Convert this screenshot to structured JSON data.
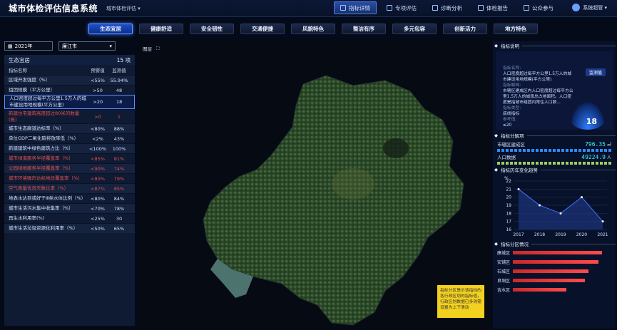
{
  "header": {
    "title": "城市体检评估信息系统",
    "system_select": "城市体检评估 ▾",
    "nav": [
      {
        "label": "指标详情",
        "active": true
      },
      {
        "label": "专项评估",
        "active": false
      },
      {
        "label": "诊断分析",
        "active": false
      },
      {
        "label": "体检报告",
        "active": false
      },
      {
        "label": "公众参与",
        "active": false
      }
    ],
    "user_label": "系统超管 ▾"
  },
  "tabs": [
    {
      "label": "生态宜居",
      "active": true
    },
    {
      "label": "健康舒适",
      "active": false
    },
    {
      "label": "安全韧性",
      "active": false
    },
    {
      "label": "交通便捷",
      "active": false
    },
    {
      "label": "风貌特色",
      "active": false
    },
    {
      "label": "整洁有序",
      "active": false
    },
    {
      "label": "多元包容",
      "active": false
    },
    {
      "label": "创新活力",
      "active": false
    },
    {
      "label": "地方特色",
      "active": false
    }
  ],
  "filters": {
    "year": "2021年",
    "city": "廉江市"
  },
  "indicator_panel": {
    "title": "生态宜居",
    "count": "15 项",
    "columns": [
      "指标名称",
      "预警值",
      "监测值"
    ],
    "rows": [
      {
        "name": "区域开发强度（%）",
        "warn": "<55%",
        "value": "55.94%",
        "status": "normal"
      },
      {
        "name": "组团规模（平方公里）",
        "warn": ">50",
        "value": "48",
        "status": "normal"
      },
      {
        "name": "人口密度超过每平方公里1.5万人的城市建设用地规模(平方公里)",
        "warn": ">20",
        "value": "18",
        "status": "selected"
      },
      {
        "name": "新建住宅建筑高度超过80米的数量(栋)",
        "warn": ">0",
        "value": "1",
        "status": "alert"
      },
      {
        "name": "城市生态廊道达标率（%）",
        "warn": "<80%",
        "value": "88%",
        "status": "normal"
      },
      {
        "name": "单位GDP二氧化碳排放降低（%）",
        "warn": "<2%",
        "value": "43%",
        "status": "normal"
      },
      {
        "name": "新建建筑中绿色建筑占比（%）",
        "warn": "<100%",
        "value": "100%",
        "status": "normal"
      },
      {
        "name": "城市绿道服务半径覆盖率（%）",
        "warn": "<85%",
        "value": "81%",
        "status": "alert"
      },
      {
        "name": "公园绿地服务半径覆盖率（%）",
        "warn": "<90%",
        "value": "74%",
        "status": "alert"
      },
      {
        "name": "城市环境噪声达标地段覆盖率（%）",
        "warn": "<80%",
        "value": "79%",
        "status": "alert"
      },
      {
        "name": "空气质量优良天数比率（%）",
        "warn": "<87%",
        "value": "85%",
        "status": "alert"
      },
      {
        "name": "地表水达到或好于Ⅲ类水体比例（%）",
        "warn": "<80%",
        "value": "84%",
        "status": "normal"
      },
      {
        "name": "城市生活污水集中收集率（%）",
        "warn": "<70%",
        "value": "78%",
        "status": "normal"
      },
      {
        "name": "再生水利用率(%)",
        "warn": "<25%",
        "value": "30",
        "status": "normal"
      },
      {
        "name": "城市生活垃圾资源化利用率（%）",
        "warn": "<50%",
        "value": "65%",
        "status": "normal"
      }
    ]
  },
  "map": {
    "layer_label": "图层"
  },
  "tooltip": {
    "text": "指标分区是示该指标的各行政区划的指标值，行政区划数据已多则需设置为上下滑动"
  },
  "right_panel": {
    "desc_title": "指标说明",
    "badge": "监测值",
    "desc_name_key": "指标名称:",
    "desc_name": "人口密度超过每平方公里1.5万人的城市建设用地规模(平方公里)",
    "desc_def_key": "指标解释:",
    "desc_def": "市辖区建成区内人口密度超过每平方公里1.5万人的城段总占地面积。人口密度是指城市组团内常住人口数...",
    "desc_type_key": "指标类型:",
    "desc_type": "底线指标",
    "desc_ref_key": "参考值:",
    "desc_ref": "≤20",
    "big_value": "18",
    "breakdown_title": "指标分解项",
    "stats": [
      {
        "label": "市辖区建成区",
        "value": "796.35",
        "unit": "㎡"
      },
      {
        "label": "人口数据",
        "value": "49224.9",
        "unit": "人"
      }
    ],
    "trend_title": "指标历年变化趋势",
    "zone_title": "指标分区情况",
    "zones": [
      {
        "name": "廉城区",
        "value": 0.92
      },
      {
        "name": "安铺区",
        "value": 0.88
      },
      {
        "name": "石城区",
        "value": 0.78
      },
      {
        "name": "良垌区",
        "value": 0.74
      },
      {
        "name": "吉水区",
        "value": 0.55
      }
    ]
  },
  "chart_data": {
    "type": "line",
    "x": [
      "2017",
      "2018",
      "2019",
      "2020",
      "2021"
    ],
    "series": [
      {
        "values": [
          21,
          19,
          18,
          20,
          17
        ]
      }
    ],
    "ylabel": "%",
    "ylim": [
      16,
      22
    ],
    "yticks": [
      16,
      17,
      18,
      19,
      20,
      21,
      22
    ],
    "grid": true,
    "colors": {
      "line": "#3c74ff",
      "fill": "#1f3b8a"
    }
  }
}
